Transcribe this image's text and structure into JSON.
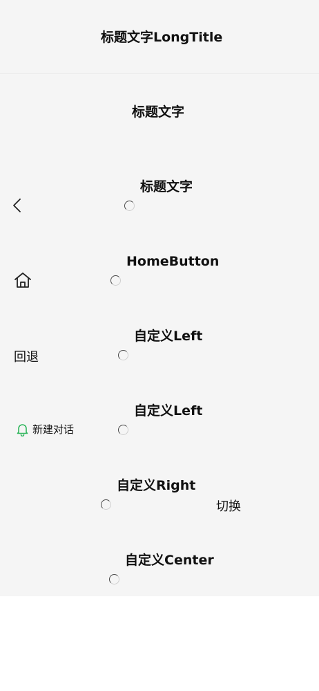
{
  "colors": {
    "bar_background": "#f5f5f5",
    "accent_green": "#2fb65c",
    "text": "#111111"
  },
  "navbars": [
    {
      "title": "标题文字LongTitle"
    },
    {
      "title": "标题文字"
    },
    {
      "title": "标题文字",
      "left_icon": "back-chevron-icon",
      "loading": true
    },
    {
      "title": "HomeButton",
      "left_icon": "home-icon",
      "loading": true
    },
    {
      "title": "自定义Left",
      "left_label": "回退",
      "loading": true
    },
    {
      "title": "自定义Left",
      "left_icon": "bell-icon",
      "left_label": "新建对话",
      "loading": true
    },
    {
      "title": "自定义Right",
      "right_label": "切换",
      "loading": true
    },
    {
      "title": "自定义Center",
      "loading": true
    }
  ]
}
